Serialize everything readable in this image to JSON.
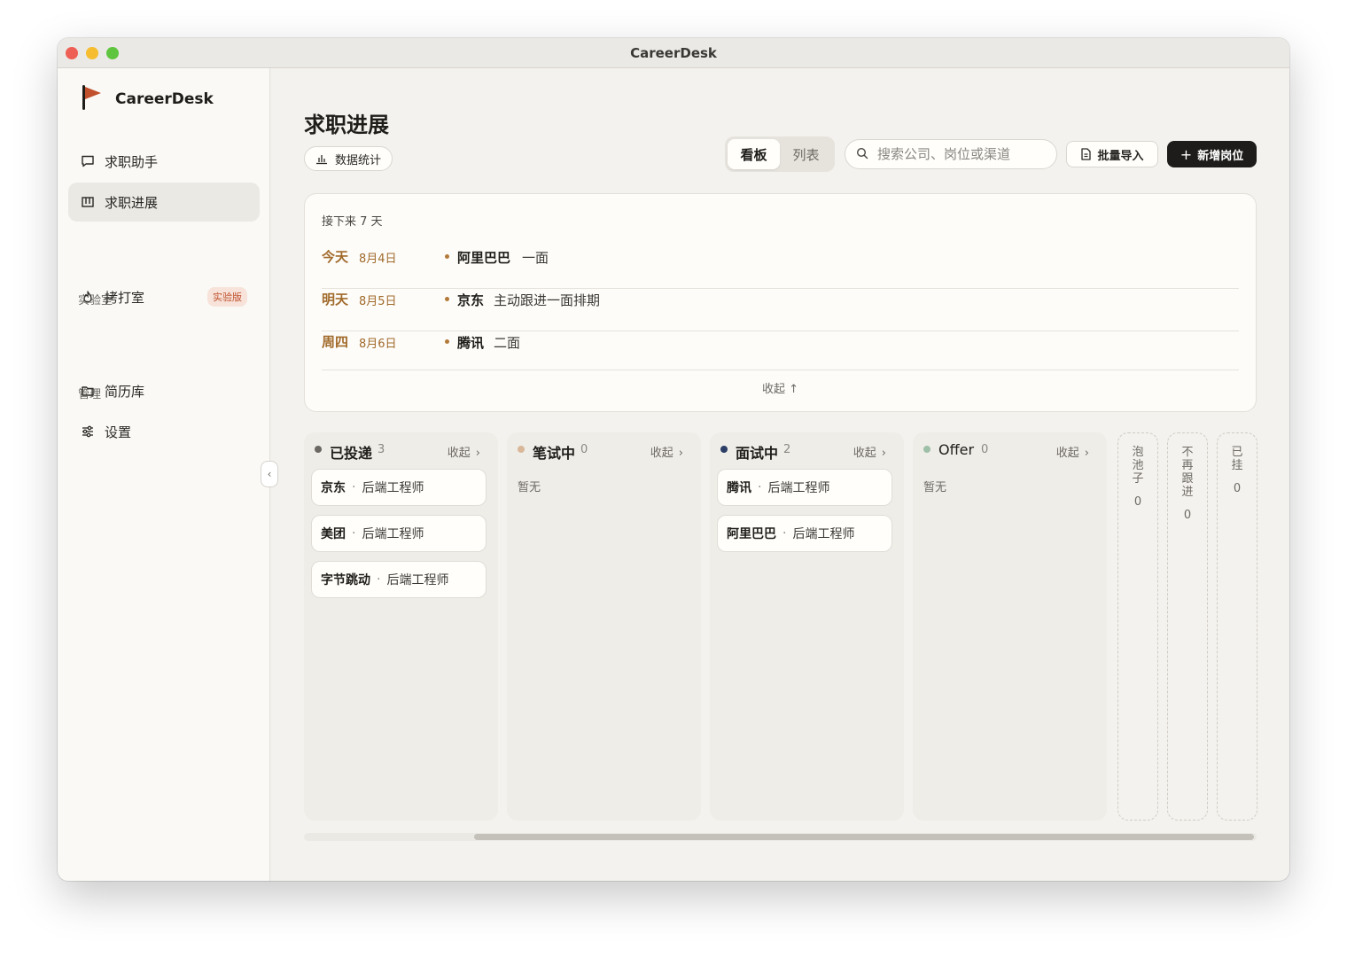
{
  "window": {
    "title": "CareerDesk"
  },
  "sidebar": {
    "brand": "CareerDesk",
    "items": [
      {
        "label": "求职助手",
        "icon": "chat-icon"
      },
      {
        "label": "求职进展",
        "icon": "kanban-icon",
        "active": true
      }
    ],
    "lab": {
      "section_label": "实验室",
      "items": [
        {
          "label": "拷打室",
          "icon": "flame-icon",
          "badge": "实验版"
        }
      ]
    },
    "manage": {
      "section_label": "管理",
      "items": [
        {
          "label": "简历库",
          "icon": "folder-icon"
        },
        {
          "label": "设置",
          "icon": "sliders-icon"
        }
      ]
    }
  },
  "header": {
    "title": "求职进展",
    "stats_button": "数据统计",
    "view_toggle": {
      "board": "看板",
      "list": "列表",
      "selected": "看板"
    },
    "search_placeholder": "搜索公司、岗位或渠道",
    "import_button": "批量导入",
    "add_button": "新增岗位",
    "add_button_icon": "+"
  },
  "upcoming": {
    "heading": "接下来 7 天",
    "rows": [
      {
        "day": "今天",
        "date": "8月4日",
        "company": "阿里巴巴",
        "detail": "一面"
      },
      {
        "day": "明天",
        "date": "8月5日",
        "company": "京东",
        "detail": "主动跟进一面排期"
      },
      {
        "day": "周四",
        "date": "8月6日",
        "company": "腾讯",
        "detail": "二面"
      }
    ],
    "collapse": "收起 ↑"
  },
  "board": {
    "fold_label": "收起",
    "fold_icon": "›",
    "empty_label": "暂无",
    "columns": [
      {
        "name": "已投递",
        "count": "3",
        "color": "#6b6864",
        "cards": [
          {
            "company": "京东",
            "role": "后端工程师"
          },
          {
            "company": "美团",
            "role": "后端工程师"
          },
          {
            "company": "字节跳动",
            "role": "后端工程师"
          }
        ]
      },
      {
        "name": "笔试中",
        "count": "0",
        "color": "#d9b89a",
        "cards": []
      },
      {
        "name": "面试中",
        "count": "2",
        "color": "#2c3e66",
        "cards": [
          {
            "company": "腾讯",
            "role": "后端工程师"
          },
          {
            "company": "阿里巴巴",
            "role": "后端工程师"
          }
        ]
      },
      {
        "name": "Offer",
        "count": "0",
        "color": "#9fc0a8",
        "cards": []
      }
    ],
    "collapsed_columns": [
      {
        "name": "泡池子",
        "count": "0"
      },
      {
        "name": "不再跟进",
        "count": "0"
      },
      {
        "name": "已挂",
        "count": "0"
      }
    ]
  },
  "card_separator": "·"
}
